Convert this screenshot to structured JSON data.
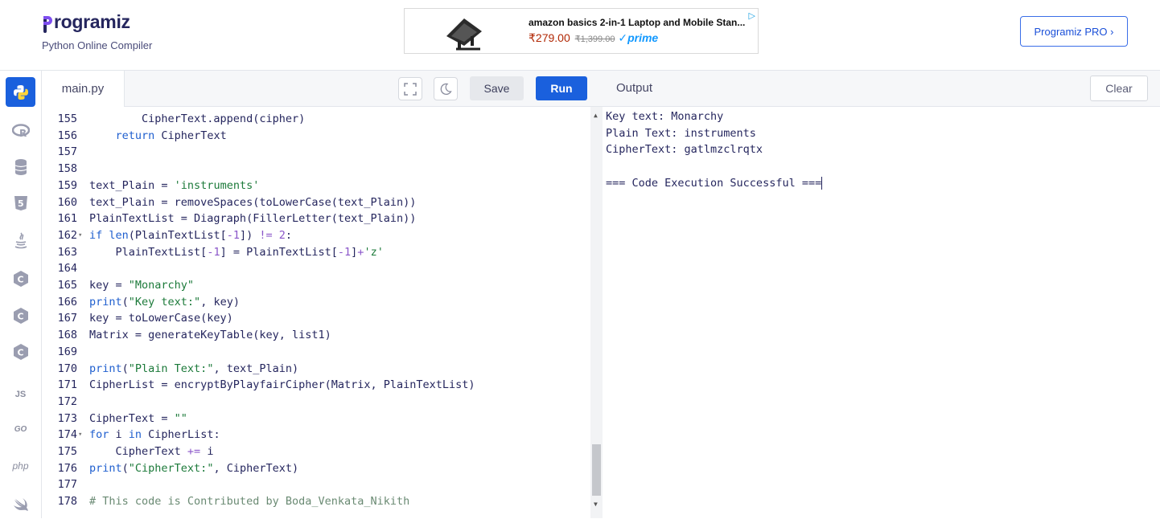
{
  "header": {
    "logo_text": "rogramiz",
    "subtitle": "Python Online Compiler",
    "pro_button": "Programiz PRO ›"
  },
  "ad": {
    "title": "amazon basics 2-in-1 Laptop and Mobile Stan...",
    "price": "₹279.00",
    "old_price": "₹1,399.00",
    "prime": "✓prime"
  },
  "sidebar": {
    "items": [
      "python-icon",
      "r-icon",
      "sql-icon",
      "html-icon",
      "java-icon",
      "c-icon",
      "cpp-icon",
      "csharp-icon",
      "JS",
      "GO",
      "php",
      "swift-icon"
    ]
  },
  "editor": {
    "tab": "main.py",
    "save_label": "Save",
    "run_label": "Run"
  },
  "code_lines": [
    {
      "n": "155",
      "t": "        CipherText.append(cipher)"
    },
    {
      "n": "156",
      "t": "    return CipherText"
    },
    {
      "n": "157",
      "t": ""
    },
    {
      "n": "158",
      "t": ""
    },
    {
      "n": "159",
      "t": "text_Plain = 'instruments'"
    },
    {
      "n": "160",
      "t": "text_Plain = removeSpaces(toLowerCase(text_Plain))"
    },
    {
      "n": "161",
      "t": "PlainTextList = Diagraph(FillerLetter(text_Plain))"
    },
    {
      "n": "162",
      "t": "if len(PlainTextList[-1]) != 2:"
    },
    {
      "n": "163",
      "t": "    PlainTextList[-1] = PlainTextList[-1]+'z'"
    },
    {
      "n": "164",
      "t": ""
    },
    {
      "n": "165",
      "t": "key = \"Monarchy\""
    },
    {
      "n": "166",
      "t": "print(\"Key text:\", key)"
    },
    {
      "n": "167",
      "t": "key = toLowerCase(key)"
    },
    {
      "n": "168",
      "t": "Matrix = generateKeyTable(key, list1)"
    },
    {
      "n": "169",
      "t": ""
    },
    {
      "n": "170",
      "t": "print(\"Plain Text:\", text_Plain)"
    },
    {
      "n": "171",
      "t": "CipherList = encryptByPlayfairCipher(Matrix, PlainTextList)"
    },
    {
      "n": "172",
      "t": ""
    },
    {
      "n": "173",
      "t": "CipherText = \"\""
    },
    {
      "n": "174",
      "t": "for i in CipherList:"
    },
    {
      "n": "175",
      "t": "    CipherText += i"
    },
    {
      "n": "176",
      "t": "print(\"CipherText:\", CipherText)"
    },
    {
      "n": "177",
      "t": ""
    },
    {
      "n": "178",
      "t": "# This code is Contributed by Boda_Venkata_Nikith"
    }
  ],
  "output": {
    "title": "Output",
    "clear_label": "Clear",
    "lines": [
      "Key text: Monarchy",
      "Plain Text: instruments",
      "CipherText: gatlmzclrqtx",
      "",
      "=== Code Execution Successful ==="
    ]
  }
}
